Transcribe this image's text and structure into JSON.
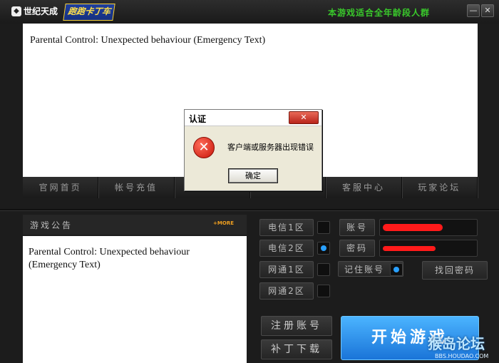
{
  "header": {
    "brand": "世纪天成",
    "brand_icon": "tiancity-logo-icon",
    "game_logo": "跑跑卡丁车",
    "age_notice": "本游戏适合全年龄段人群",
    "minimize_label": "—",
    "close_label": "✕"
  },
  "top_panel": {
    "message": "Parental Control: Unexpected behaviour (Emergency Text)"
  },
  "nav": {
    "items": [
      "官网首页",
      "帐号充值",
      "",
      "",
      "客服中心",
      "玩家论坛"
    ]
  },
  "notice": {
    "title": "游戏公告",
    "more": "+MORE",
    "message": "Parental Control: Unexpected behaviour (Emergency Text)"
  },
  "servers": [
    {
      "label": "电信1区",
      "selected": false
    },
    {
      "label": "电信2区",
      "selected": true
    },
    {
      "label": "网通1区",
      "selected": false
    },
    {
      "label": "网通2区",
      "selected": false
    }
  ],
  "login": {
    "account_label": "账号",
    "password_label": "密码",
    "remember_label": "记住账号",
    "find_password": "找回密码"
  },
  "buttons": {
    "register": "注册账号",
    "patch": "补丁下载",
    "start": "开始游戏"
  },
  "watermark": {
    "text": "猴岛论坛",
    "sub": "BBS.HOUDAO.COM"
  },
  "dialog": {
    "title": "认证",
    "message": "客户端或服务器出现错误",
    "ok": "确定",
    "close": "✕",
    "icon": "error-icon"
  },
  "colors": {
    "accent_green": "#39c82b",
    "start_blue": "#1a74d8",
    "radio_on": "#29a0ff",
    "redaction": "#ff1a1a"
  }
}
